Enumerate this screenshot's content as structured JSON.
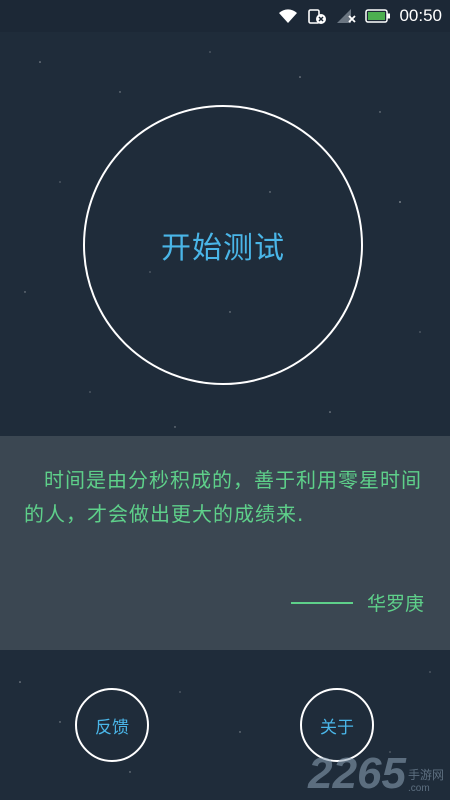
{
  "status_bar": {
    "time": "00:50",
    "icons": [
      "wifi-icon",
      "sim-error-icon",
      "no-signal-icon",
      "battery-icon"
    ],
    "battery_color": "#4caf50"
  },
  "main": {
    "start_button_label": "开始测试"
  },
  "quote": {
    "text": "时间是由分秒积成的，善于利用零星时间的人，才会做出更大的成绩来.",
    "author": "华罗庚"
  },
  "bottom_buttons": {
    "feedback_label": "反馈",
    "about_label": "关于"
  },
  "watermark": {
    "big": "2265",
    "small_top": "手游网",
    "small_bottom": ".com"
  },
  "colors": {
    "background": "#1f2c3a",
    "accent_blue": "#4ab6e8",
    "quote_green": "#5ed08a",
    "panel": "#3b4752"
  }
}
